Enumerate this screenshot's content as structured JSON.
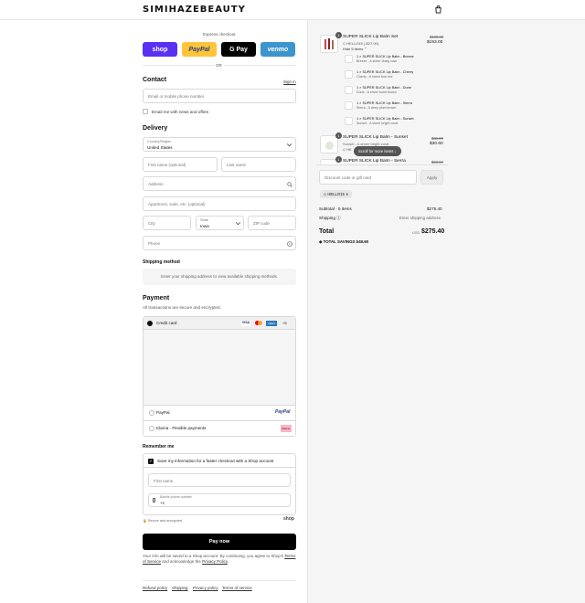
{
  "brand": "SIMIHAZEBEAUTY",
  "express": {
    "title": "Express checkout",
    "shop": "shop",
    "paypal": "PayPal",
    "gpay": "G Pay",
    "venmo": "venmo",
    "or": "OR"
  },
  "contact": {
    "title": "Contact",
    "sign_in": "Sign in",
    "email_placeholder": "Email or mobile phone number",
    "news": "Email me with news and offers"
  },
  "delivery": {
    "title": "Delivery",
    "country_label": "Country/Region",
    "country": "United States",
    "first": "First name (optional)",
    "last": "Last name",
    "address": "Address",
    "apt": "Apartment, suite, etc. (optional)",
    "city": "City",
    "state_label": "State",
    "state": "Iowa",
    "zip": "ZIP code",
    "phone": "Phone"
  },
  "shipping": {
    "title": "Shipping method",
    "note": "Enter your shipping address to view available shipping methods."
  },
  "payment": {
    "title": "Payment",
    "subtitle": "All transactions are secure and encrypted.",
    "credit": "Credit card",
    "more": "+5",
    "paypal": "PayPal",
    "paypal_logo": "PayPal",
    "klarna": "Klarna - Flexible payments",
    "klarna_logo": "Klarna."
  },
  "remember": {
    "title": "Remember me",
    "save": "Save my information for a faster checkout with a Shop account",
    "first": "First name",
    "mobile_label": "Mobile phone number",
    "mobile_prefix": "+1",
    "secure": "Secure and encrypted",
    "shop": "shop"
  },
  "pay_now": "Pay now",
  "legal": {
    "pre": "Your info will be saved to a Shop account. By continuing, you agree to Shop's",
    "terms": "Terms of Service",
    "mid": "and acknowledge the",
    "privacy": "Privacy Policy",
    "end": "."
  },
  "footer": [
    "Refund policy",
    "Shipping",
    "Privacy policy",
    "Terms of service"
  ],
  "cart": {
    "item1": {
      "name": "SUPER SLICK Lip Balm Set",
      "code": "HELLO15 (-$27.00)",
      "old": "$180.00",
      "price": "$153.00",
      "qty": "1",
      "hide": "Hide 5 items"
    },
    "subs": [
      {
        "name": "1 × SUPER SLICK Lip Balm - Breeze",
        "desc": "Breeze - A sheer dusty rose"
      },
      {
        "name": "1 × SUPER SLICK Lip Balm - Cherry",
        "desc": "Cherry - A sheer true red"
      },
      {
        "name": "1 × SUPER SLICK Lip Balm - Dune",
        "desc": "Dune - A sheer burnt brown"
      },
      {
        "name": "1 × SUPER SLICK Lip Balm - Sierra",
        "desc": "Sierra - A deep plum brown"
      },
      {
        "name": "1 × SUPER SLICK Lip Balm - Sunset",
        "desc": "Sunset - A sheer bright coral"
      }
    ],
    "item2": {
      "name": "SUPER SLICK Lip Balm - Sunset",
      "desc": "Sunset - A sheer bright coral",
      "code": "HE",
      "old": "$36.00",
      "price": "$30.60",
      "qty": "1"
    },
    "item3": {
      "name": "SUPER SLICK Lip Balm - Sierra",
      "old": "$36.00",
      "qty": "1"
    },
    "scroll": "Scroll for more items",
    "discount_placeholder": "Discount code or gift card",
    "apply": "Apply",
    "code_tag": "HELLO15",
    "subtotal_label": "Subtotal · 5 items",
    "subtotal": "$275.40",
    "shipping_label": "Shipping",
    "shipping_value": "Enter shipping address",
    "total_label": "Total",
    "currency": "USD",
    "total": "$275.40",
    "savings_label": "TOTAL SAVINGS",
    "savings": "$48.60"
  },
  "colors": {
    "shop": "#5a31f4",
    "paypal": "#ffc439",
    "gpay": "#000000",
    "venmo": "#3d95ce",
    "klarna": "#ffb3c7"
  }
}
